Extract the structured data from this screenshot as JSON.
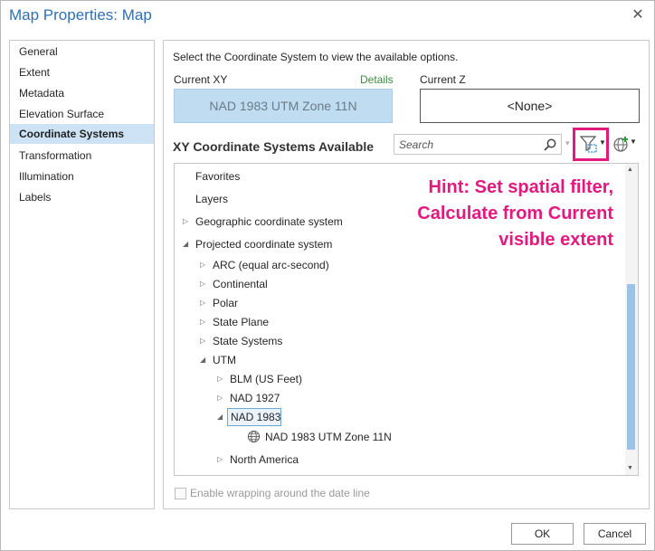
{
  "window": {
    "title": "Map Properties: Map",
    "close_glyph": "✕"
  },
  "sidebar": {
    "items": [
      {
        "label": "General"
      },
      {
        "label": "Extent"
      },
      {
        "label": "Metadata"
      },
      {
        "label": "Elevation Surface"
      },
      {
        "label": "Coordinate Systems",
        "selected": true
      },
      {
        "label": "Transformation"
      },
      {
        "label": "Illumination"
      },
      {
        "label": "Labels"
      }
    ]
  },
  "main": {
    "instruction": "Select the Coordinate System to view the available options.",
    "current_xy_label": "Current XY",
    "details_link": "Details",
    "current_z_label": "Current Z",
    "current_xy_value": "NAD 1983 UTM Zone 11N",
    "current_z_value": "<None>",
    "available_heading": "XY Coordinate Systems Available",
    "search_placeholder": "Search",
    "hint_lines": [
      "Hint: Set spatial filter,",
      "Calculate from Current",
      "visible extent"
    ],
    "tree": [
      {
        "label": "Favorites",
        "level": 0,
        "caret": ""
      },
      {
        "label": "Layers",
        "level": 0,
        "caret": ""
      },
      {
        "label": "Geographic coordinate system",
        "level": 0,
        "caret": "collapsed"
      },
      {
        "label": "Projected coordinate system",
        "level": 0,
        "caret": "expanded"
      },
      {
        "label": "ARC (equal arc-second)",
        "level": 1,
        "caret": "collapsed"
      },
      {
        "label": "Continental",
        "level": 1,
        "caret": "collapsed"
      },
      {
        "label": "Polar",
        "level": 1,
        "caret": "collapsed"
      },
      {
        "label": "State Plane",
        "level": 1,
        "caret": "collapsed"
      },
      {
        "label": "State Systems",
        "level": 1,
        "caret": "collapsed"
      },
      {
        "label": "UTM",
        "level": 1,
        "caret": "expanded"
      },
      {
        "label": "BLM (US Feet)",
        "level": 2,
        "caret": "collapsed"
      },
      {
        "label": "NAD 1927",
        "level": 2,
        "caret": "collapsed"
      },
      {
        "label": "NAD 1983",
        "level": 2,
        "caret": "expanded",
        "selected": true
      },
      {
        "label": "NAD 1983 UTM Zone 11N",
        "level": 3,
        "caret": "",
        "icon": "globe-icon"
      },
      {
        "label": "North America",
        "level": 2,
        "caret": "collapsed"
      }
    ],
    "wrap_label": "Enable wrapping around the date line"
  },
  "footer": {
    "ok_label": "OK",
    "cancel_label": "Cancel"
  },
  "colors": {
    "accent": "#e2197e",
    "title": "#2f6fb5",
    "selected": "#cde3f5",
    "xy_box": "#bfdcf1"
  },
  "icons": [
    "close-icon",
    "search-icon",
    "spatial-filter-icon",
    "add-coordinate-system-icon",
    "globe-icon",
    "caret-icon"
  ]
}
